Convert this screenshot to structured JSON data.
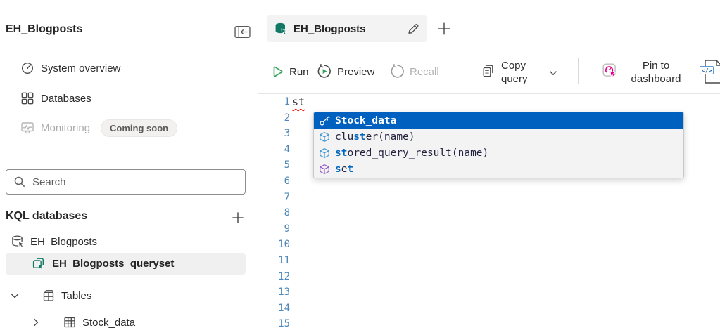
{
  "colors": {
    "accent_teal": "#117865",
    "run_green": "#35A05C",
    "pin_pink": "#E3008C",
    "selected_blue": "#0060C0",
    "match_blue": "#0066BF",
    "function_icon_blue": "#3794D1",
    "keyword_icon_purple": "#9256C5",
    "line_number_blue": "#4E87B8",
    "squiggle_red": "#E51400",
    "text_dark": "#252525",
    "text_gray": "#5F5F5F",
    "disabled_gray": "#ABABAB",
    "border_gray": "#E6E6E6",
    "suggest_text": "#23233F",
    "suggest_bg": "#F3F3F3"
  },
  "sidebar": {
    "title": "EH_Blogposts",
    "nav": [
      {
        "label": "System overview"
      },
      {
        "label": "Databases"
      },
      {
        "label": "Monitoring",
        "badge": "Coming soon"
      }
    ],
    "search": {
      "placeholder": "Search"
    },
    "kql_header": "KQL databases",
    "tree": {
      "database": "EH_Blogposts",
      "queryset": "EH_Blogposts_queryset",
      "tables": "Tables",
      "table": "Stock_data"
    }
  },
  "tab": {
    "title": "EH_Blogposts"
  },
  "toolbar": {
    "run": "Run",
    "preview": "Preview",
    "recall": "Recall",
    "copy_query_line1": "Copy",
    "copy_query_line2": "query",
    "pin_line1": "Pin to",
    "pin_line2": "dashboard",
    "code_glyph": "</>"
  },
  "editor": {
    "line_count": 15,
    "typed_text": "st",
    "suggestions": [
      {
        "kind": "table",
        "selected": true,
        "segments": [
          {
            "t": "Stock_data",
            "m": false
          }
        ]
      },
      {
        "kind": "function",
        "selected": false,
        "segments": [
          {
            "t": "clu",
            "m": false
          },
          {
            "t": "st",
            "m": true
          },
          {
            "t": "er(name)",
            "m": false
          }
        ]
      },
      {
        "kind": "function",
        "selected": false,
        "segments": [
          {
            "t": "st",
            "m": true
          },
          {
            "t": "ored_query_result(name)",
            "m": false
          }
        ]
      },
      {
        "kind": "keyword",
        "selected": false,
        "segments": [
          {
            "t": "s",
            "m": true
          },
          {
            "t": "e",
            "m": false
          },
          {
            "t": "t",
            "m": true
          }
        ]
      }
    ]
  }
}
